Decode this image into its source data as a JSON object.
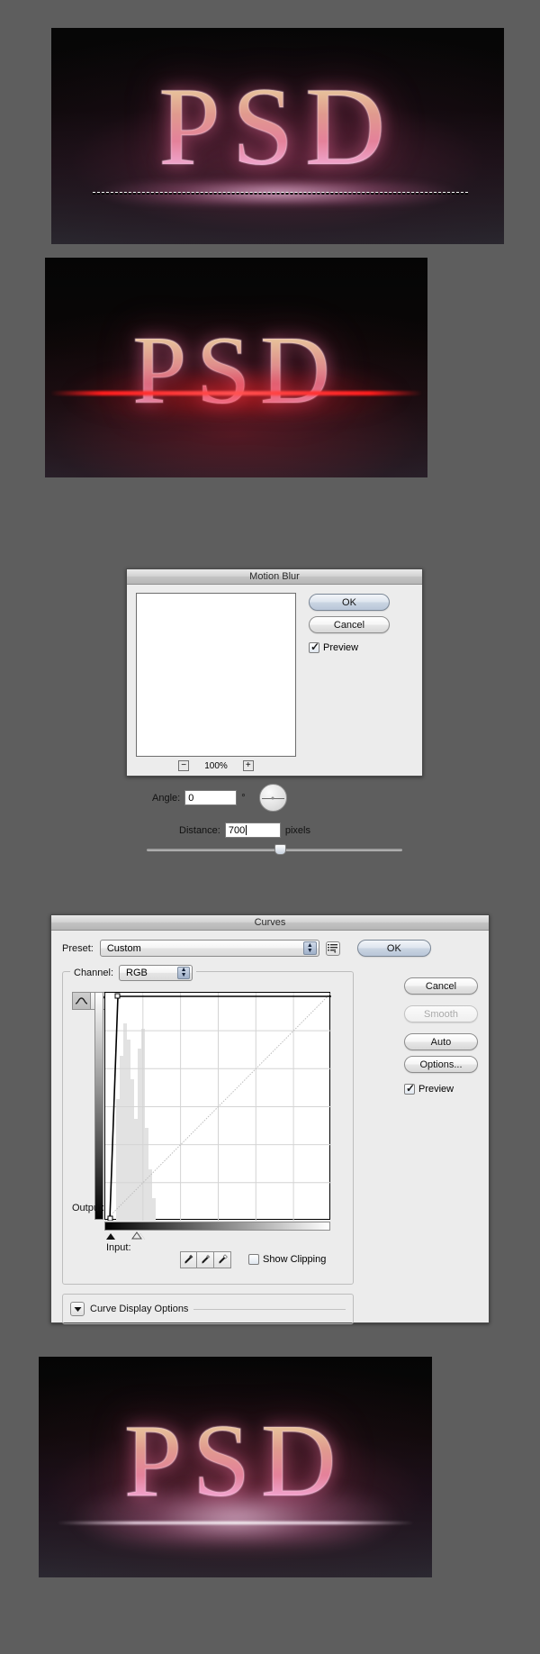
{
  "background_color": "#5e5e5e",
  "artwork": {
    "text": "PSD",
    "panels": [
      {
        "name": "step-1-selection",
        "caption_text": "PSD",
        "description": "Glowing PSD text on dark background with marching-ants rectangular selection across the baseline",
        "has_selection": true,
        "glow_color": "#ff9ad2"
      },
      {
        "name": "step-2-red-line",
        "caption_text": "PSD",
        "description": "Glowing PSD text with a bright red horizontal light streak along the baseline",
        "has_selection": false,
        "glow_color": "#ff1414"
      },
      {
        "name": "step-3-final",
        "caption_text": "PSD",
        "description": "Final PSD text with soft white-pink light streak and reflection on the floor",
        "has_selection": false,
        "glow_color": "#ffd9f2"
      }
    ]
  },
  "motion_blur_dialog": {
    "title": "Motion Blur",
    "buttons": {
      "ok": "OK",
      "cancel": "Cancel"
    },
    "preview_checkbox": {
      "label": "Preview",
      "checked": true
    },
    "zoom": {
      "minus": "−",
      "plus": "+",
      "value": "100%"
    },
    "angle": {
      "label": "Angle:",
      "value": "0",
      "unit": "°"
    },
    "distance": {
      "label": "Distance:",
      "value": "700",
      "unit": "pixels"
    }
  },
  "curves_dialog": {
    "title": "Curves",
    "preset": {
      "label": "Preset:",
      "value": "Custom"
    },
    "channel": {
      "label": "Channel:",
      "value": "RGB"
    },
    "buttons": {
      "ok": "OK",
      "cancel": "Cancel",
      "smooth": "Smooth",
      "auto": "Auto",
      "options": "Options..."
    },
    "preview_checkbox": {
      "label": "Preview",
      "checked": true
    },
    "show_clipping_checkbox": {
      "label": "Show Clipping",
      "checked": false
    },
    "output_label": "Output:",
    "input_label": "Input:",
    "curve_display_options": "Curve Display Options",
    "icons": {
      "preset_menu": "preset-menu-icon",
      "curve_tool": "curve-pencil-icon",
      "pencil_tool": "pencil-icon",
      "eyedropper_black": "eyedropper-black-icon",
      "eyedropper_gray": "eyedropper-gray-icon",
      "eyedropper_white": "eyedropper-white-icon",
      "disclosure": "disclosure-triangle-icon"
    },
    "curve": {
      "description": "Steep contrast curve: near-vertical rise from input 0 to a control point, then flat at maximum output",
      "control_points": [
        [
          0,
          0
        ],
        [
          14,
          255
        ]
      ],
      "diagonal_reference": true,
      "grid_divisions": 10
    }
  }
}
